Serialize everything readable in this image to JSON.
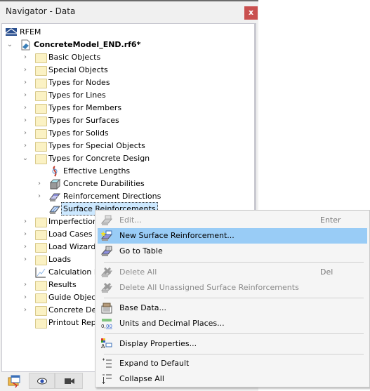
{
  "panel": {
    "title": "Navigator - Data",
    "close_label": "x"
  },
  "tree": {
    "root": "RFEM",
    "model": "ConcreteModel_END.rf6*",
    "items": [
      {
        "label": "Basic Objects",
        "expandable": true
      },
      {
        "label": "Special Objects",
        "expandable": true
      },
      {
        "label": "Types for Nodes",
        "expandable": true
      },
      {
        "label": "Types for Lines",
        "expandable": true
      },
      {
        "label": "Types for Members",
        "expandable": true
      },
      {
        "label": "Types for Surfaces",
        "expandable": true
      },
      {
        "label": "Types for Solids",
        "expandable": true
      },
      {
        "label": "Types for Special Objects",
        "expandable": true
      },
      {
        "label": "Types for Concrete Design",
        "expanded": true
      },
      {
        "label": "Effective Lengths",
        "icon": "effective-lengths-icon"
      },
      {
        "label": "Concrete Durabilities",
        "icon": "concrete-durability-icon",
        "expandable": true
      },
      {
        "label": "Reinforcement Directions",
        "icon": "reinforcement-direction-icon",
        "expandable": true
      },
      {
        "label": "Surface Reinforcements",
        "icon": "surface-reinforcement-icon",
        "selected": true
      },
      {
        "label": "Imperfections",
        "expandable": true
      },
      {
        "label": "Load Cases & Combinations",
        "expandable": true
      },
      {
        "label": "Load Wizards",
        "expandable": true
      },
      {
        "label": "Loads",
        "expandable": true
      },
      {
        "label": "Calculation Diagrams",
        "icon": "calculation-diagram-icon"
      },
      {
        "label": "Results",
        "expandable": true
      },
      {
        "label": "Guide Objects",
        "expandable": true
      },
      {
        "label": "Concrete Design",
        "expandable": true
      },
      {
        "label": "Printout Reports"
      }
    ]
  },
  "bottom_tabs": [
    {
      "name": "data-tab",
      "icon": "navigator-data-icon"
    },
    {
      "name": "display-tab",
      "icon": "eye-icon"
    },
    {
      "name": "views-tab",
      "icon": "video-camera-icon"
    }
  ],
  "context_menu": {
    "items": [
      {
        "label": "Edit...",
        "shortcut": "Enter",
        "disabled": true
      },
      {
        "label": "New Surface Reinforcement...",
        "highlighted": true
      },
      {
        "label": "Go to Table"
      },
      {
        "label": "Delete All",
        "shortcut": "Del",
        "disabled": true
      },
      {
        "label": "Delete All Unassigned Surface Reinforcements",
        "disabled": true
      },
      {
        "label": "Base Data..."
      },
      {
        "label": "Units and Decimal Places..."
      },
      {
        "label": "Display Properties..."
      },
      {
        "label": "Expand to Default"
      },
      {
        "label": "Collapse All"
      }
    ],
    "highlight_color": "#99ccf6"
  }
}
